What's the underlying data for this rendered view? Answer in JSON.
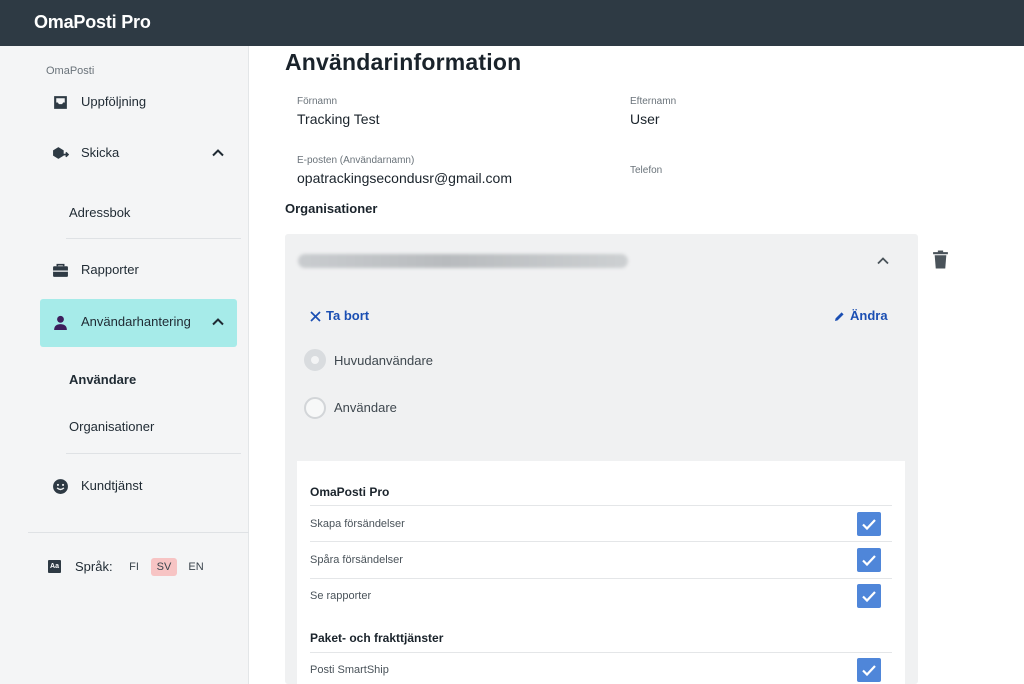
{
  "app": {
    "brand": "OmaPosti Pro"
  },
  "sidebar": {
    "section_label": "OmaPosti",
    "items": [
      {
        "label": "Uppföljning",
        "icon": "inbox-icon"
      },
      {
        "label": "Skicka",
        "icon": "parcel-send-icon"
      },
      {
        "label": "Rapporter",
        "icon": "briefcase-icon"
      },
      {
        "label": "Användarhantering",
        "icon": "user-icon"
      },
      {
        "label": "Kundtjänst",
        "icon": "smiley-icon"
      }
    ],
    "skicka_sub": [
      "Adressbok"
    ],
    "user_mgmt_sub": [
      "Användare",
      "Organisationer"
    ],
    "language": {
      "label": "Språk:",
      "options": [
        "FI",
        "SV",
        "EN"
      ],
      "selected": "SV"
    }
  },
  "main": {
    "title": "Användarinformation",
    "fields": {
      "first_name_label": "Förnamn",
      "first_name_value": "Tracking Test",
      "last_name_label": "Efternamn",
      "last_name_value": "User",
      "email_label": "E-posten (Användarnamn)",
      "email_value": "opatrackingsecondusr@gmail.com",
      "phone_label": "Telefon",
      "phone_value": ""
    },
    "organizations_heading": "Organisationer",
    "org_card": {
      "remove_label": "Ta bort",
      "edit_label": "Ändra",
      "roles": [
        {
          "label": "Huvudanvändare",
          "checked": true
        },
        {
          "label": "Användare",
          "checked": false
        }
      ],
      "permission_groups": [
        {
          "title": "OmaPosti Pro",
          "items": [
            {
              "label": "Skapa försändelser",
              "checked": true
            },
            {
              "label": "Spåra försändelser",
              "checked": true
            },
            {
              "label": "Se rapporter",
              "checked": true
            }
          ]
        },
        {
          "title": "Paket- och frakttjänster",
          "items": [
            {
              "label": "Posti SmartShip",
              "checked": true
            }
          ]
        }
      ]
    }
  },
  "colors": {
    "topbar": "#2e3a44",
    "active_nav": "#a6ebe9",
    "accent_link": "#1b4fb3",
    "checkbox": "#4f86d9",
    "lang_selected": "#f7c4c4"
  }
}
